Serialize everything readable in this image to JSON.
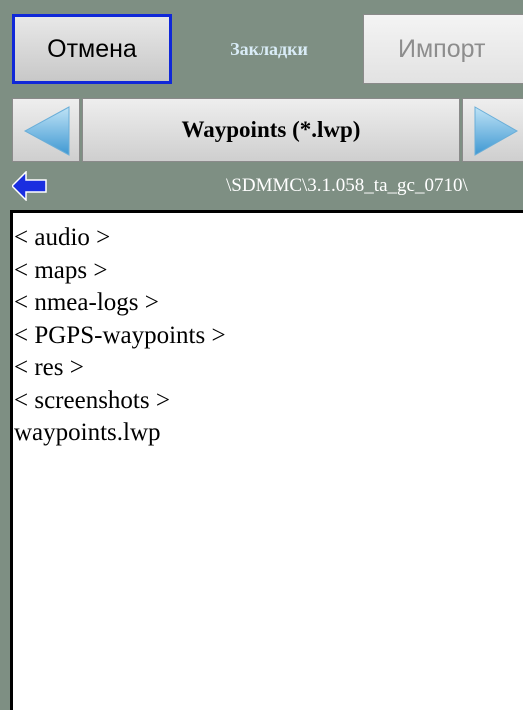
{
  "toolbar": {
    "cancel_label": "Отмена",
    "bookmarks_label": "Закладки",
    "import_label": "Импорт"
  },
  "filter": {
    "label": "Waypoints (*.lwp)"
  },
  "path": {
    "text": "\\SDMMC\\3.1.058_ta_gc_0710\\"
  },
  "files": {
    "items": [
      "< audio >",
      "< maps >",
      "< nmea-logs >",
      "< PGPS-waypoints >",
      "< res >",
      "< screenshots >",
      "waypoints.lwp"
    ]
  },
  "icons": {
    "prev": "left-triangle-icon",
    "next": "right-triangle-icon",
    "back": "back-arrow-icon"
  },
  "colors": {
    "background": "#7e8f83",
    "accent_border": "#1028d8",
    "arrow_blue": "#4aa3d8",
    "back_arrow": "#1a2ee0"
  }
}
